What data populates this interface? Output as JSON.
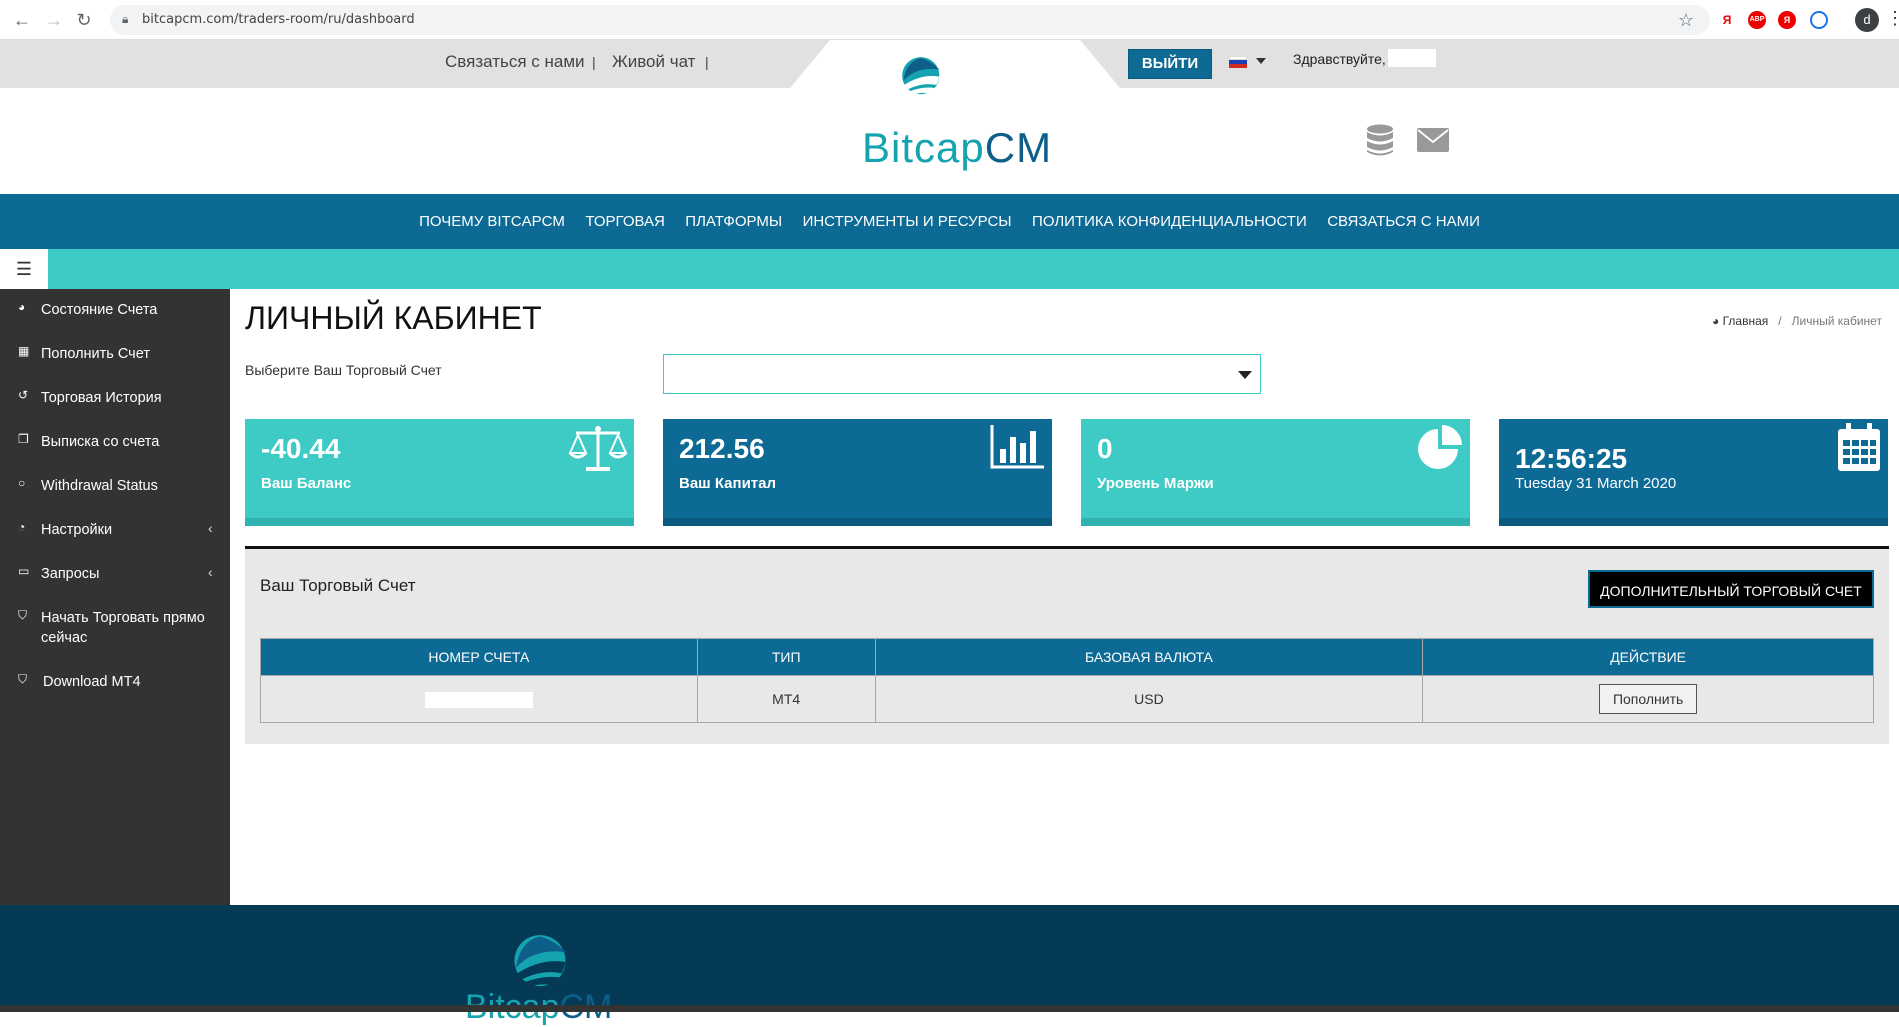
{
  "browser": {
    "url": "bitcapcm.com/traders-room/ru/dashboard",
    "profile_initial": "d",
    "ext_labels": [
      "Я",
      "ABP",
      "Я"
    ]
  },
  "topbar": {
    "contact": "Связаться с нами",
    "live_chat": "Живой чат",
    "separator": "|",
    "exit": "ВЫЙТИ",
    "greeting": "Здравствуйте,"
  },
  "logo": {
    "part1": "Bitcap",
    "part2": "CM"
  },
  "nav": {
    "items": [
      "ПОЧЕМУ BITCAPCM",
      "ТОРГОВАЯ",
      "ПЛАТФОРМЫ",
      "ИНСТРУМЕНТЫ И РЕСУРСЫ",
      "ПОЛИТИКА КОНФИДЕНЦИАЛЬНОСТИ",
      "СВЯЗАТЬСЯ С НАМИ"
    ]
  },
  "sidebar": {
    "items": [
      {
        "label": "Состояние Счета",
        "icon": "dashboard-icon"
      },
      {
        "label": "Пополнить Счет",
        "icon": "grid-icon"
      },
      {
        "label": "Торговая История",
        "icon": "history-icon"
      },
      {
        "label": "Выписка со счета",
        "icon": "copy-icon"
      },
      {
        "label": "Withdrawal Status",
        "icon": "circle-icon"
      },
      {
        "label": "Настройки",
        "icon": "pie-icon"
      },
      {
        "label": "Запросы",
        "icon": "laptop-icon"
      },
      {
        "label": "Начать Торговать прямо",
        "label2": "сейчас",
        "icon": "shield-icon"
      },
      {
        "label": "Download MT4",
        "icon": "shield-icon"
      }
    ]
  },
  "main": {
    "title": "ЛИЧНЫЙ КАБИНЕТ",
    "breadcrumb": {
      "home": "Главная",
      "sep": "/",
      "current": "Личный кабинет"
    },
    "select_label": "Выберите Ваш Торговый Счет",
    "cards": [
      {
        "value": "-40.44",
        "label": "Ваш Баланс",
        "icon": "scale-icon",
        "color": "#3ecbc6"
      },
      {
        "value": "212.56",
        "label": "Ваш Капитал",
        "icon": "bar-chart-icon",
        "color": "#0c6a94"
      },
      {
        "value": "0",
        "label": "Уровень Маржи",
        "icon": "pie-chart-icon",
        "color": "#3ecbc6"
      },
      {
        "value": "12:56:25",
        "label": "Tuesday 31 March 2020",
        "icon": "calendar-icon",
        "color": "#0c6a94"
      }
    ],
    "panel": {
      "title": "Ваш Торговый Счет",
      "extra_button": "ДОПОЛНИТЕЛЬНЫЙ ТОРГОВЫЙ СЧЕТ",
      "columns": [
        "НОМЕР СЧЕТА",
        "ТИП",
        "БАЗОВАЯ ВАЛЮТА",
        "ДЕЙСТВИЕ"
      ],
      "rows": [
        {
          "type": "MT4",
          "currency": "USD",
          "action": "Пополнить"
        }
      ]
    }
  },
  "colors": {
    "primary": "#0c6a94",
    "accent": "#3ecbc6",
    "sidebar": "#333333",
    "footer": "#043a55"
  }
}
